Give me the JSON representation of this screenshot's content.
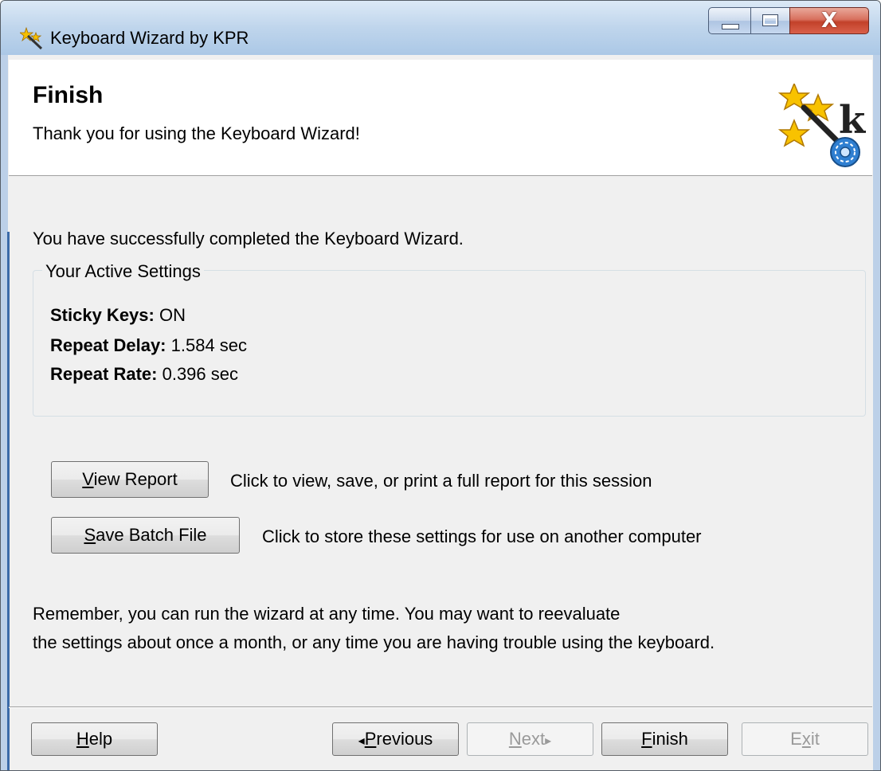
{
  "window": {
    "title": "Keyboard Wizard by KPR",
    "minimize_label": "_",
    "close_glyph": "X"
  },
  "header": {
    "title": "Finish",
    "subtitle": "Thank you for using the Keyboard Wizard!",
    "logo_letter": "k"
  },
  "body": {
    "completed_text": "You have successfully completed the Keyboard Wizard.",
    "settings_group": {
      "legend": "Your Active Settings",
      "items": [
        {
          "label": "Sticky Keys:",
          "value": " ON"
        },
        {
          "label": "Repeat Delay:",
          "value": " 1.584 sec"
        },
        {
          "label": "Repeat Rate:",
          "value": " 0.396 sec"
        }
      ]
    },
    "view_report": {
      "label_mnemonic": "V",
      "label_rest": "iew Report",
      "description": "Click to view, save, or print a full report for this session"
    },
    "save_batch": {
      "label_mnemonic": "S",
      "label_rest": "ave Batch File",
      "description": "Click to store these settings for use on another computer"
    },
    "reminder_line1": "Remember, you can run the wizard at any time. You may want to reevaluate",
    "reminder_line2": "the settings about once a month, or any time you are having trouble using the keyboard."
  },
  "footer": {
    "help": {
      "mnemonic": "H",
      "rest": "elp"
    },
    "previous": {
      "arrow": "◂",
      "mnemonic": "P",
      "rest": "revious"
    },
    "next": {
      "mnemonic": "N",
      "rest": "ext",
      "arrow": "▸"
    },
    "finish": {
      "mnemonic": "F",
      "rest": "inish"
    },
    "exit": {
      "pre": "E",
      "mnemonic": "x",
      "rest": "it"
    }
  }
}
